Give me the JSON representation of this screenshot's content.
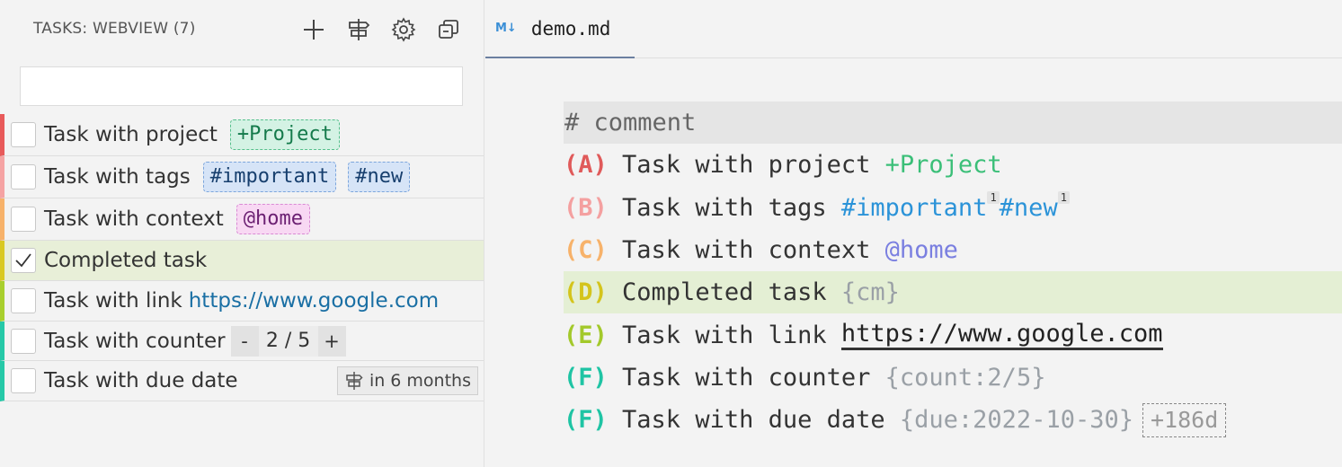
{
  "sidebar": {
    "title": "TASKS: WEBVIEW (7)",
    "actions": [
      {
        "name": "add-icon"
      },
      {
        "name": "signpost-icon"
      },
      {
        "name": "gear-icon"
      },
      {
        "name": "collapse-icon"
      }
    ],
    "filter": {
      "value": "",
      "placeholder": ""
    },
    "tasks": [
      {
        "title": "Task with project",
        "priority_color": "#e85a5a",
        "project": "+Project"
      },
      {
        "title": "Task with tags",
        "priority_color": "#f5a3a3",
        "tags": [
          "#important",
          "#new"
        ]
      },
      {
        "title": "Task with context",
        "priority_color": "#f7b26a",
        "context": "@home"
      },
      {
        "title": "Completed task",
        "priority_color": "#d9c921",
        "completed": true
      },
      {
        "title": "Task with link",
        "priority_color": "#a9cf2e",
        "link": "https://www.google.com"
      },
      {
        "title": "Task with counter",
        "priority_color": "#26c9a8",
        "counter": {
          "minus": "-",
          "value": "2 / 5",
          "plus": "+"
        }
      },
      {
        "title": "Task with due date",
        "priority_color": "#26c9a8",
        "due": "in 6 months"
      }
    ]
  },
  "editor": {
    "tab": {
      "icon_label": "M↓",
      "label": "demo.md"
    },
    "colors": {
      "A": "#e05a5a",
      "B": "#f4a0a0",
      "C": "#f7b26a",
      "D": "#d4c41c",
      "E": "#a3c92b",
      "F": "#1fc4a4"
    },
    "lines": {
      "comment": "# comment",
      "l1": {
        "pri": "(A)",
        "text": " Task with project ",
        "project": "+Project"
      },
      "l2": {
        "pri": "(B)",
        "text": " Task with tags ",
        "tag1": "#important",
        "tag1_count": "1",
        "tag2": "#new",
        "tag2_count": "1"
      },
      "l3": {
        "pri": "(C)",
        "text": " Task with context ",
        "context": "@home"
      },
      "l4": {
        "pri": "(D)",
        "text": " Completed task ",
        "meta": "{cm}"
      },
      "l5": {
        "pri": "(E)",
        "text": " Task with link ",
        "url": "https://www.google.com"
      },
      "l6": {
        "pri": "(F)",
        "text": " Task with counter ",
        "meta": "{count:2/5}"
      },
      "l7": {
        "pri": "(F)",
        "text": " Task with due date ",
        "meta": "{due:2022-10-30}",
        "relative": "+186d"
      }
    }
  }
}
